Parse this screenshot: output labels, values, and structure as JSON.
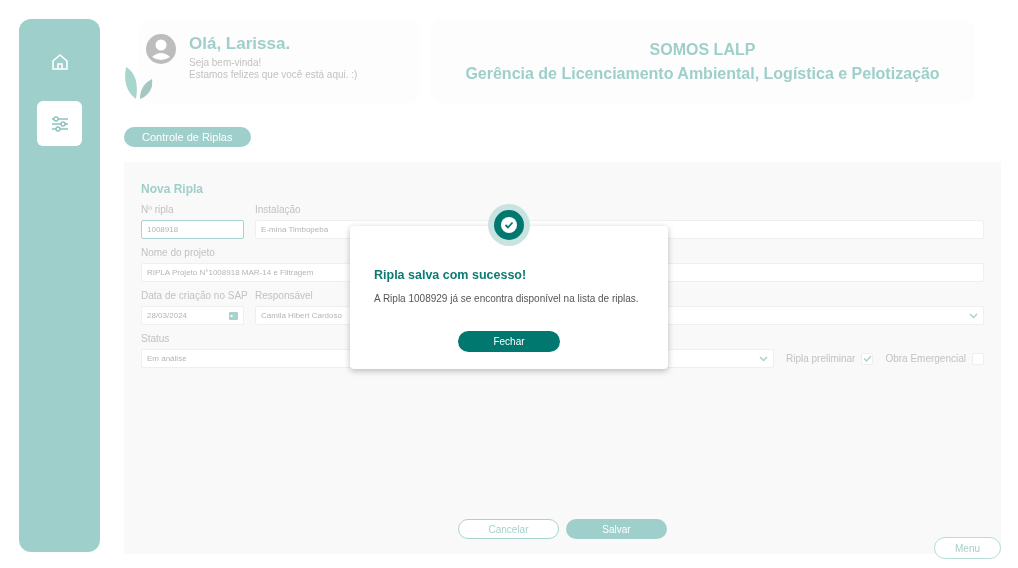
{
  "sidebar": {
    "items": [
      {
        "kind": "home",
        "selected": false
      },
      {
        "kind": "settings",
        "selected": true
      }
    ]
  },
  "greeting": {
    "title": "Olá, Larissa.",
    "lines": [
      "Seja bem-vinda!",
      "Estamos felizes que você está aqui. :)"
    ]
  },
  "banner": {
    "title": "SOMOS LALP",
    "subtitle": "Gerência de Licenciamento Ambiental, Logística e Pelotização"
  },
  "section_button": "Controle de Riplas",
  "form": {
    "title": "Nova Ripla",
    "rows": [
      [
        {
          "label": "Nº ripla",
          "value": "1008918",
          "kind": "text",
          "focused": true
        },
        {
          "label": "Instalação",
          "value": "E-mina Timbopeba",
          "kind": "text",
          "focused": false
        }
      ],
      [
        {
          "label": "Nome do projeto",
          "value": "RIPLA Projeto N°1008918 MAR-14 e Filtragem",
          "kind": "text",
          "focused": false
        }
      ],
      [
        {
          "label": "Data de criação no SAP",
          "value": "28/03/2024",
          "kind": "date",
          "focused": false
        },
        {
          "label": "Responsável",
          "value": "Camila Hibert Cardoso",
          "kind": "text",
          "focused": false
        },
        {
          "kind": "select",
          "focused": false
        }
      ],
      [
        {
          "label": "Status",
          "value": "Em análise",
          "kind": "text",
          "focused": false
        },
        {
          "kind": "select",
          "focused": false
        }
      ]
    ],
    "checkboxes": [
      {
        "label": "Ripla preliminar",
        "checked": true
      },
      {
        "label": "Obra Emergencial",
        "checked": false
      }
    ]
  },
  "actions": [
    {
      "label": "Cancelar",
      "kind": "outline"
    },
    {
      "label": "Salvar",
      "kind": "filled"
    }
  ],
  "menu_button": "Menu",
  "modal": {
    "title": "Ripla salva com sucesso!",
    "message": "A Ripla 1008929 já se encontra disponível na lista de riplas.",
    "button": "Fechar"
  }
}
